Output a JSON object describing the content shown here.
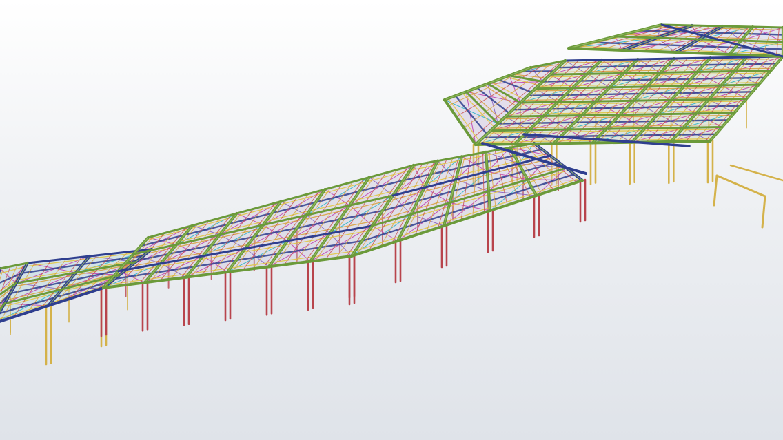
{
  "scene": {
    "subject": "steel-structure-3d-model",
    "colors": {
      "background_top": "#ffffff",
      "background_bottom": "#dfe3e9",
      "girder_green": "#6b9a3a",
      "girder_navy": "#2f3f8f",
      "beam_orange": "#d9a03a",
      "brace_magenta": "#c040b0",
      "brace_cyan": "#2fb5c8",
      "purlin_red": "#c84a4a",
      "purlin_yellow": "#e2c63c",
      "column_yellow": "#d4b24a",
      "column_red": "#b8444c",
      "purple_bracing": "#8860c0"
    }
  }
}
